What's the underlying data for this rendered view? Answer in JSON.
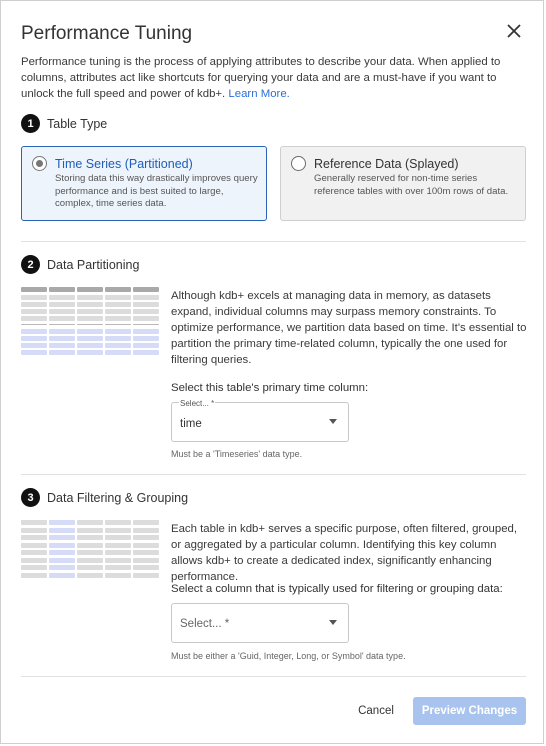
{
  "dialog": {
    "title": "Performance Tuning",
    "close_icon": "close-icon",
    "intro_text": "Performance tuning is the process of applying attributes to describe your data. When applied to columns, attributes act like shortcuts for querying your data and are a must-have if you want to unlock the full speed and power of kdb+.",
    "learn_more": "Learn More."
  },
  "table_type": {
    "step_number": "1",
    "heading": "Table Type",
    "options": [
      {
        "title": "Time Series (Partitioned)",
        "description": "Storing data this way drastically improves query performance and is best suited to large, complex, time series data.",
        "selected": true
      },
      {
        "title": "Reference Data (Splayed)",
        "description": "Generally reserved for non-time series reference tables with over 100m rows of data.",
        "selected": false
      }
    ]
  },
  "partitioning": {
    "step_number": "2",
    "heading": "Data Partitioning",
    "description": "Although kdb+ excels at managing data in memory, as datasets expand, individual columns may surpass memory constraints. To optimize performance, we partition data based on time. It's essential to partition the primary time-related column, typically the one used for filtering queries.",
    "select_prompt": "Select this table's primary time column:",
    "select_legend": "Select... *",
    "select_value": "time",
    "hint": "Must be a 'Timeseries' data type.",
    "illustration_icon": "partitioned-table-icon"
  },
  "filtering": {
    "step_number": "3",
    "heading": "Data Filtering & Grouping",
    "description": "Each table in kdb+ serves a specific purpose, often filtered, grouped, or aggregated by a particular column. Identifying this key column allows kdb+ to create a dedicated index, significantly enhancing performance.",
    "select_prompt": "Select a column that is typically used for filtering or grouping data:",
    "select_placeholder": "Select... *",
    "hint": "Must be either a 'Guid, Integer, Long, or Symbol' data type.",
    "illustration_icon": "indexed-column-table-icon"
  },
  "footer": {
    "cancel_label": "Cancel",
    "preview_label": "Preview Changes"
  },
  "colors": {
    "accent": "#2a63b8",
    "link": "#2a6fd6",
    "selected_card_bg": "#eef4fc",
    "highlight_cell": "#d6dcf8",
    "grey_cell": "#dcdcdc",
    "header_cell": "#a9a9a9",
    "preview_disabled": "#a8c4ee"
  }
}
